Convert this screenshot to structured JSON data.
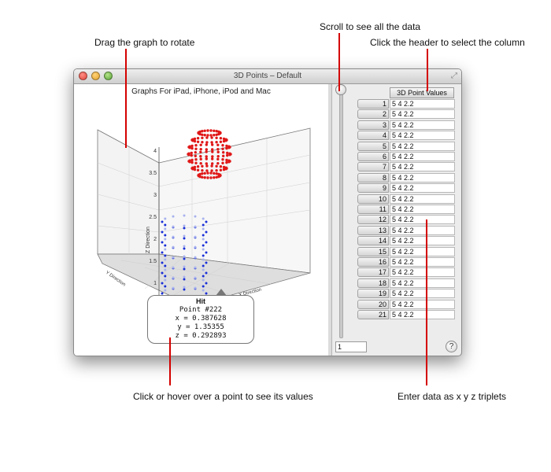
{
  "annotations": {
    "rotate": "Drag the graph to rotate",
    "scroll": "Scroll to see all the data",
    "header": "Click the header to select the column",
    "hover": "Click or hover over a point to see its values",
    "enter": "Enter data as x y z triplets"
  },
  "window": {
    "title": "3D Points – Default",
    "graph_title": "Graphs For iPad, iPhone, iPod and Mac"
  },
  "graph": {
    "z_axis_label": "Z Direction",
    "z_ticks": [
      "4",
      "3.5",
      "3",
      "2.5",
      "2",
      "1.5",
      "1"
    ],
    "y_axis_label": "Y Direction",
    "x_axis_label": "X Direction",
    "point_colors": {
      "sphere": "#e01818",
      "cylinder": "#1a2fd8",
      "cylinder_faint": "#a8b2ee"
    }
  },
  "tooltip": {
    "heading": "Hit",
    "point": "Point #222",
    "x": "x = 0.387628",
    "y": "y = 1.35355",
    "z": "z = 0.292893"
  },
  "table": {
    "header": "3D Point Values",
    "rows": [
      {
        "n": "1",
        "v": "5 4 2.2"
      },
      {
        "n": "2",
        "v": "5 4 2.2"
      },
      {
        "n": "3",
        "v": "5 4 2.2"
      },
      {
        "n": "4",
        "v": "5 4 2.2"
      },
      {
        "n": "5",
        "v": "5 4 2.2"
      },
      {
        "n": "6",
        "v": "5 4 2.2"
      },
      {
        "n": "7",
        "v": "5 4 2.2"
      },
      {
        "n": "8",
        "v": "5 4 2.2"
      },
      {
        "n": "9",
        "v": "5 4 2.2"
      },
      {
        "n": "10",
        "v": "5 4 2.2"
      },
      {
        "n": "11",
        "v": "5 4 2.2"
      },
      {
        "n": "12",
        "v": "5 4 2.2"
      },
      {
        "n": "13",
        "v": "5 4 2.2"
      },
      {
        "n": "14",
        "v": "5 4 2.2"
      },
      {
        "n": "15",
        "v": "5 4 2.2"
      },
      {
        "n": "16",
        "v": "5 4 2.2"
      },
      {
        "n": "17",
        "v": "5 4 2.2"
      },
      {
        "n": "18",
        "v": "5 4 2.2"
      },
      {
        "n": "19",
        "v": "5 4 2.2"
      },
      {
        "n": "20",
        "v": "5 4 2.2"
      },
      {
        "n": "21",
        "v": "5 4 2.2"
      }
    ]
  },
  "footer": {
    "page_value": "1",
    "help": "?"
  },
  "colors": {
    "callout": "#d40000"
  }
}
